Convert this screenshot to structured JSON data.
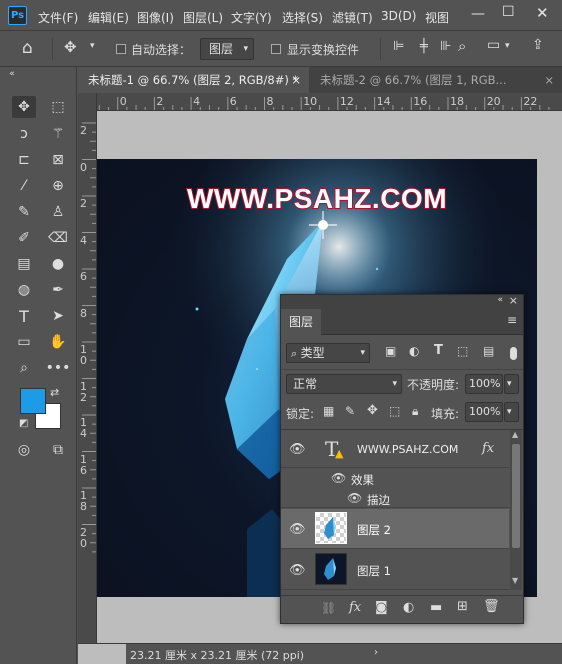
{
  "app": {
    "logo": "Ps"
  },
  "menu": [
    "文件(F)",
    "编辑(E)",
    "图像(I)",
    "图层(L)",
    "文字(Y)",
    "选择(S)",
    "滤镜(T)",
    "3D(D)",
    "视图"
  ],
  "options_bar": {
    "auto_select_label": "自动选择：",
    "auto_select_value": "图层",
    "show_transform_label": "显示变换控件"
  },
  "tabs": [
    {
      "label": "未标题-1 @ 66.7% (图层 2, RGB/8#) *",
      "close": "×"
    },
    {
      "label": "未标题-2 @ 66.7% (图层 1, RGB...",
      "close": "×"
    }
  ],
  "hruler_ticks": [
    "2",
    "0",
    "2",
    "4",
    "6",
    "8",
    "10",
    "12",
    "14",
    "16",
    "18",
    "20",
    "22"
  ],
  "vruler_ticks": [
    "2",
    "0",
    "2",
    "4",
    "6",
    "8",
    "1\n0",
    "1\n2",
    "1\n4",
    "1\n6",
    "1\n8",
    "2\n0"
  ],
  "document": {
    "watermark": "WWW.PSAHZ.COM"
  },
  "status": {
    "doc_size": "23.21 厘米 x 23.21 厘米 (72 ppi)"
  },
  "layers_panel": {
    "tab_title": "图层",
    "filter_label": "类型",
    "blend_mode": "正常",
    "opacity_label": "不透明度:",
    "opacity_value": "100%",
    "lock_label": "锁定:",
    "fill_label": "填充:",
    "fill_value": "100%",
    "layers": [
      {
        "name": "WWW.PSAHZ.COM",
        "kind": "text",
        "fx": "fx"
      },
      {
        "name": "图层 2",
        "kind": "pixel",
        "selected": true
      },
      {
        "name": "图层 1",
        "kind": "pixel"
      }
    ],
    "effects_label": "效果",
    "stroke_label": "描边"
  },
  "colors": {
    "foreground": "#1e9be6",
    "background": "#ffffff",
    "accent": "#31a8ff"
  }
}
